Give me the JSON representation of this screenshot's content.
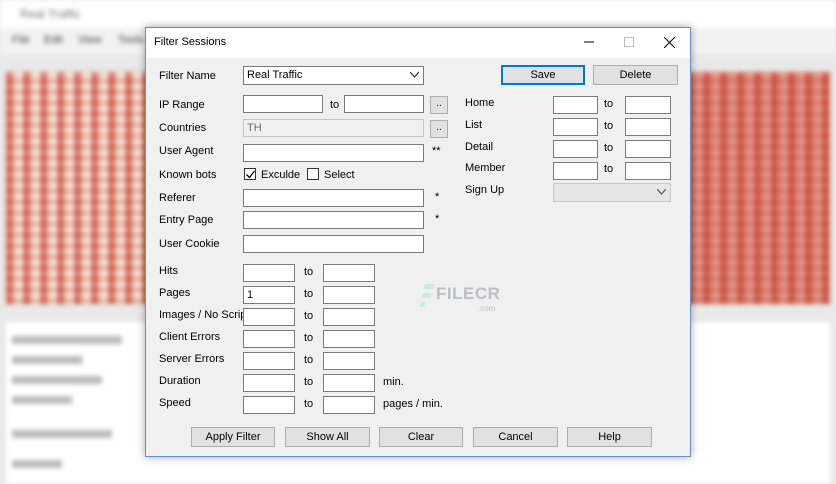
{
  "background_app": {
    "title": "Real Traffic",
    "menu": [
      "File",
      "Edit",
      "View",
      "Tools",
      "Help"
    ]
  },
  "dialog": {
    "title": "Filter Sessions",
    "filter_name_label": "Filter Name",
    "filter_name_value": "Real Traffic",
    "save_label": "Save",
    "delete_label": "Delete",
    "ip_range_label": "IP Range",
    "to": "to",
    "browse": "..",
    "countries_label": "Countries",
    "countries_value": "TH",
    "user_agent_label": "User Agent",
    "user_agent_mark": "**",
    "known_bots_label": "Known bots",
    "exclude_label": "Exculde",
    "exclude_checked": true,
    "select_label": "Select",
    "select_checked": false,
    "referer_label": "Referer",
    "entry_page_label": "Entry Page",
    "star": "*",
    "user_cookie_label": "User Cookie",
    "hits_label": "Hits",
    "pages_label": "Pages",
    "pages_from": "1",
    "images_label": "Images / No Script",
    "client_errors_label": "Client Errors",
    "server_errors_label": "Server Errors",
    "duration_label": "Duration",
    "duration_unit": "min.",
    "speed_label": "Speed",
    "speed_unit": "pages / min.",
    "home_label": "Home",
    "list_label": "List",
    "detail_label": "Detail",
    "member_label": "Member",
    "signup_label": "Sign Up",
    "signup_value": "",
    "buttons": {
      "apply_filter": "Apply Filter",
      "show_all": "Show All",
      "clear": "Clear",
      "cancel": "Cancel",
      "help": "Help"
    }
  },
  "watermark": {
    "text": "FILECR",
    "suffix": ".com"
  },
  "colors": {
    "accent": "#0078d7",
    "dialog_bg": "#f0f0f0",
    "watermark": "#b9bfc6"
  }
}
